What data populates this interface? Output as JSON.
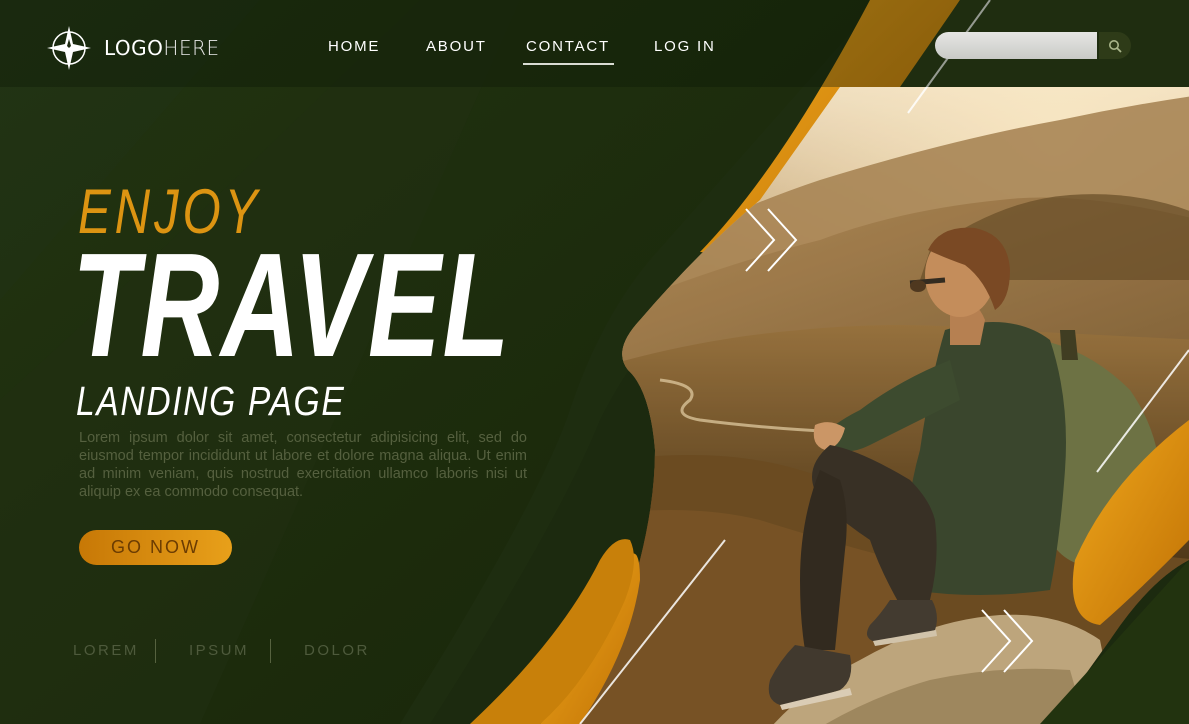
{
  "brand": {
    "logo_bold": "LOGO",
    "logo_light": "HERE"
  },
  "nav": {
    "items": [
      {
        "label": "HOME"
      },
      {
        "label": "ABOUT"
      },
      {
        "label": "CONTACT",
        "active": true
      },
      {
        "label": "LOG IN"
      }
    ]
  },
  "search": {
    "value": "",
    "placeholder": ""
  },
  "hero": {
    "kicker": "ENJOY",
    "title": "TRAVEL",
    "subtitle": "LANDING PAGE",
    "body": "Lorem ipsum dolor sit amet, consectetur adipisicing elit, sed do eiusmod tempor incididunt ut labore et dolore magna aliqua. Ut enim ad minim veniam, quis nostrud exercitation ullamco laboris nisi ut aliquip ex ea commodo consequat.",
    "cta_label": "GO NOW"
  },
  "footer": {
    "links": [
      {
        "label": "LOREM"
      },
      {
        "label": "IPSUM"
      },
      {
        "label": "DOLOR"
      }
    ]
  },
  "colors": {
    "background_dark_green": "#1d2a10",
    "accent_orange": "#dc9412",
    "text_white": "#ffffff",
    "muted_green_text": "#55603f"
  },
  "icons": {
    "logo": "compass-star-icon",
    "search": "search-icon",
    "chevrons": "double-chevron-right-icon"
  }
}
